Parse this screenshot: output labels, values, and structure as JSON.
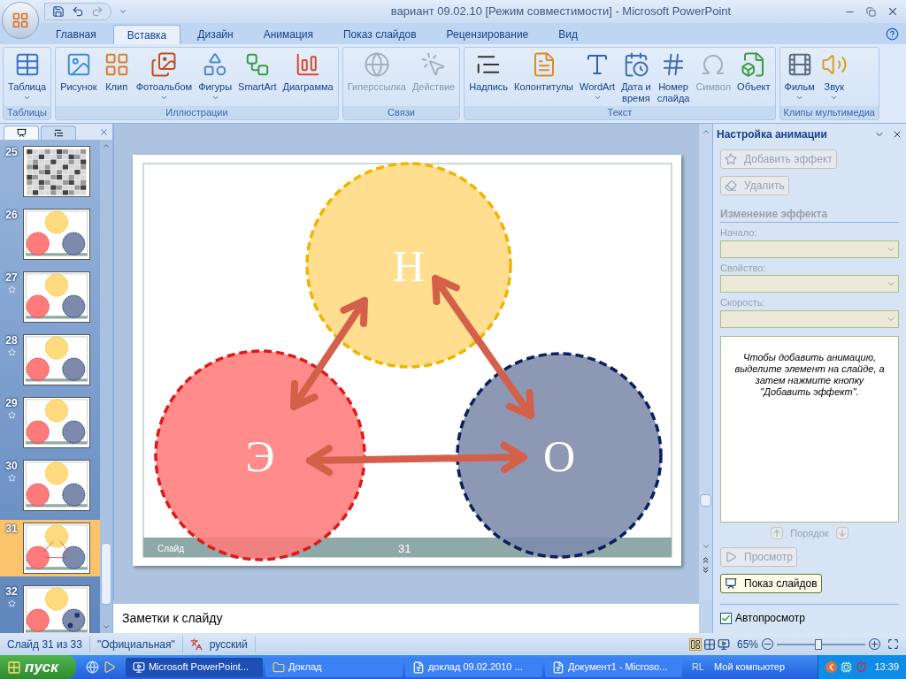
{
  "window": {
    "title": "вариант 09.02.10 [Режим совместимости] - Microsoft PowerPoint"
  },
  "ribbon_tabs": [
    {
      "label": "Главная",
      "selected": false
    },
    {
      "label": "Вставка",
      "selected": true
    },
    {
      "label": "Дизайн",
      "selected": false
    },
    {
      "label": "Анимация",
      "selected": false
    },
    {
      "label": "Показ слайдов",
      "selected": false
    },
    {
      "label": "Рецензирование",
      "selected": false
    },
    {
      "label": "Вид",
      "selected": false
    }
  ],
  "ribbon_groups": [
    {
      "label": "Таблицы",
      "buttons": [
        {
          "label": "Таблица",
          "disabled": false,
          "dropdown": true
        }
      ]
    },
    {
      "label": "Иллюстрации",
      "buttons": [
        {
          "label": "Рисунок",
          "disabled": false,
          "dropdown": false
        },
        {
          "label": "Клип",
          "disabled": false,
          "dropdown": false
        },
        {
          "label": "Фотоальбом",
          "disabled": false,
          "dropdown": true
        },
        {
          "label": "Фигуры",
          "disabled": false,
          "dropdown": true
        },
        {
          "label": "SmartArt",
          "disabled": false,
          "dropdown": false
        },
        {
          "label": "Диаграмма",
          "disabled": false,
          "dropdown": false
        }
      ]
    },
    {
      "label": "Связи",
      "buttons": [
        {
          "label": "Гиперссылка",
          "disabled": true,
          "dropdown": false
        },
        {
          "label": "Действие",
          "disabled": true,
          "dropdown": false
        }
      ]
    },
    {
      "label": "Текст",
      "buttons": [
        {
          "label": "Надпись",
          "disabled": false,
          "dropdown": false
        },
        {
          "label": "Колонтитулы",
          "disabled": false,
          "dropdown": false
        },
        {
          "label": "WordArt",
          "disabled": false,
          "dropdown": true
        },
        {
          "label": "Дата и\nвремя",
          "disabled": false,
          "dropdown": false
        },
        {
          "label": "Номер\nслайда",
          "disabled": false,
          "dropdown": false
        },
        {
          "label": "Символ",
          "disabled": true,
          "dropdown": false
        },
        {
          "label": "Объект",
          "disabled": false,
          "dropdown": false
        }
      ]
    },
    {
      "label": "Клипы мультимедиа",
      "buttons": [
        {
          "label": "Фильм",
          "disabled": false,
          "dropdown": true
        },
        {
          "label": "Звук",
          "disabled": false,
          "dropdown": true
        }
      ]
    }
  ],
  "slide_thumbnails": [
    {
      "number": "25",
      "kind": "table",
      "animated": false,
      "selected": false
    },
    {
      "number": "26",
      "kind": "circles",
      "animated": false,
      "selected": false
    },
    {
      "number": "27",
      "kind": "circles",
      "animated": true,
      "selected": false
    },
    {
      "number": "28",
      "kind": "circles",
      "animated": true,
      "selected": false
    },
    {
      "number": "29",
      "kind": "circles",
      "animated": true,
      "selected": false
    },
    {
      "number": "30",
      "kind": "circles",
      "animated": true,
      "selected": false
    },
    {
      "number": "31",
      "kind": "arrows",
      "animated": false,
      "selected": true
    },
    {
      "number": "32",
      "kind": "dots",
      "animated": true,
      "selected": false
    }
  ],
  "slide": {
    "circles": [
      {
        "label": "Н",
        "color": "#ffdb80"
      },
      {
        "label": "Э",
        "color": "#ff7b7b"
      },
      {
        "label": "О",
        "color": "#7d8aab"
      }
    ],
    "footer_label": "Слайд",
    "footer_number": "31"
  },
  "notes": {
    "text": "Заметки к слайду"
  },
  "task_pane": {
    "title": "Настройка анимации",
    "add_effect": {
      "label": "Добавить эффект",
      "disabled": true
    },
    "remove": {
      "label": "Удалить",
      "disabled": true
    },
    "section_title": "Изменение эффекта",
    "fields": [
      {
        "label": "Начало:",
        "disabled": true
      },
      {
        "label": "Свойство:",
        "disabled": true
      },
      {
        "label": "Скорость:",
        "disabled": true
      }
    ],
    "hint": "Чтобы добавить анимацию, выделите элемент на слайде, а затем нажмите кнопку \"Добавить эффект\".",
    "order_label": "Порядок",
    "preview": {
      "label": "Просмотр",
      "disabled": true
    },
    "slideshow": {
      "label": "Показ слайдов",
      "disabled": false
    },
    "autopreview": {
      "label": "Автопросмотр",
      "checked": true
    }
  },
  "status_bar": {
    "items": [
      "Слайд 31 из 33",
      "\"Официальная\"",
      "русский"
    ],
    "zoom": "65%",
    "zoom_slider": {
      "level": 0.47
    }
  },
  "taskbar": {
    "start": "пуск",
    "tasks": [
      {
        "label": "Microsoft PowerPoint...",
        "kind": "program",
        "selected": true
      },
      {
        "label": "Доклад",
        "kind": "folder",
        "selected": false
      },
      {
        "label": "доклад 09.02.2010 ...",
        "kind": "document",
        "selected": false
      },
      {
        "label": "Документ1 - Microso...",
        "kind": "document",
        "selected": false
      }
    ],
    "language": "RL",
    "toolbar_label": "Мой компьютер",
    "clock": "13:39"
  }
}
